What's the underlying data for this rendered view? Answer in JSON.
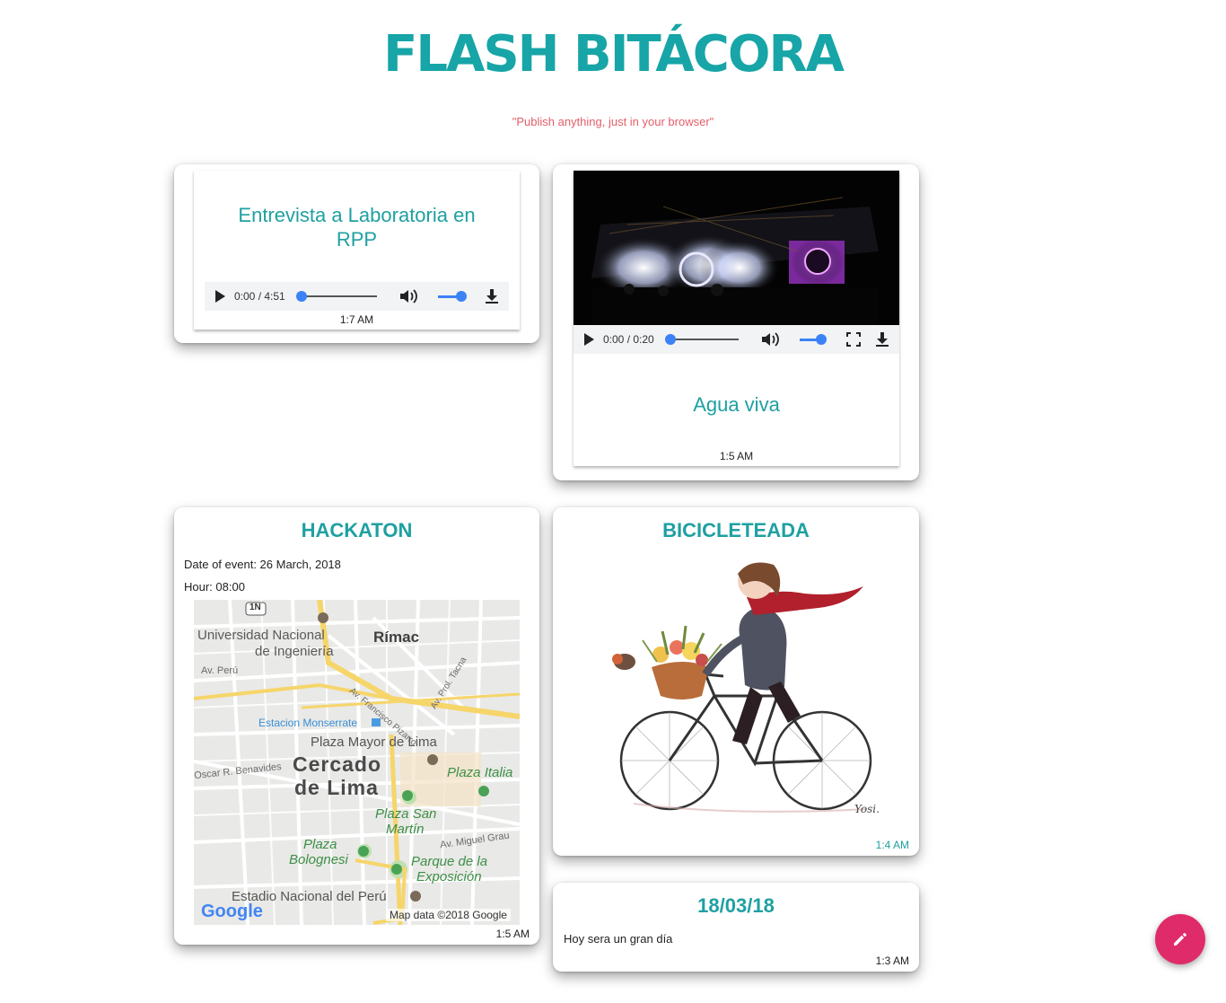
{
  "header": {
    "title": "FLASH BITÁCORA",
    "subtitle": "\"Publish anything, just in your browser\""
  },
  "colors": {
    "accent": "#17a5a7",
    "subtitle": "#e25e6a",
    "fab": "#e02b6a",
    "player_progress": "#3b82f6"
  },
  "posts": {
    "audio": {
      "title": "Entrevista a Laboratoria en RPP",
      "player_time": "0:00 / 4:51",
      "time": "1:7 AM"
    },
    "video": {
      "title": "Agua viva",
      "player_time": "0:00 / 0:20",
      "time": "1:5 AM"
    },
    "event": {
      "title": "HACKATON",
      "date_line": "Date of event: 26 March, 2018",
      "hour_line": "Hour: 08:00",
      "time": "1:5 AM",
      "map": {
        "labels": {
          "uni": "Universidad Nacional",
          "uni2": "de Ingeniería",
          "rimac": "Rímac",
          "av_peru": "Av. Perú",
          "francisco": "Av. Francisco Pizarro",
          "tacna": "Av. Prol. Tacna",
          "monserrate": "Estacion Monserrate",
          "plaza_mayor": "Plaza Mayor de Lima",
          "benavides": "Oscar R. Benavides",
          "cercado": "Cercado",
          "de_lima": "de Lima",
          "plaza_italia": "Plaza Italia",
          "san_martin": "Plaza San",
          "san_martin2": "Martín",
          "grau": "Av. Miguel Grau",
          "bolognesi": "Plaza",
          "bolognesi2": "Bolognesi",
          "parque": "Parque de la",
          "parque2": "Exposición",
          "estadio": "Estadio Nacional del Perú",
          "route": "1N",
          "logo": "Google",
          "credit": "Map data ©2018 Google"
        }
      }
    },
    "image": {
      "title": "BICICLETEADA",
      "time": "1:4 AM",
      "signature": "Yosi."
    },
    "text": {
      "title": "18/03/18",
      "body": "Hoy sera un gran día",
      "time": "1:3 AM"
    }
  },
  "fab": {
    "icon": "pencil-icon"
  }
}
